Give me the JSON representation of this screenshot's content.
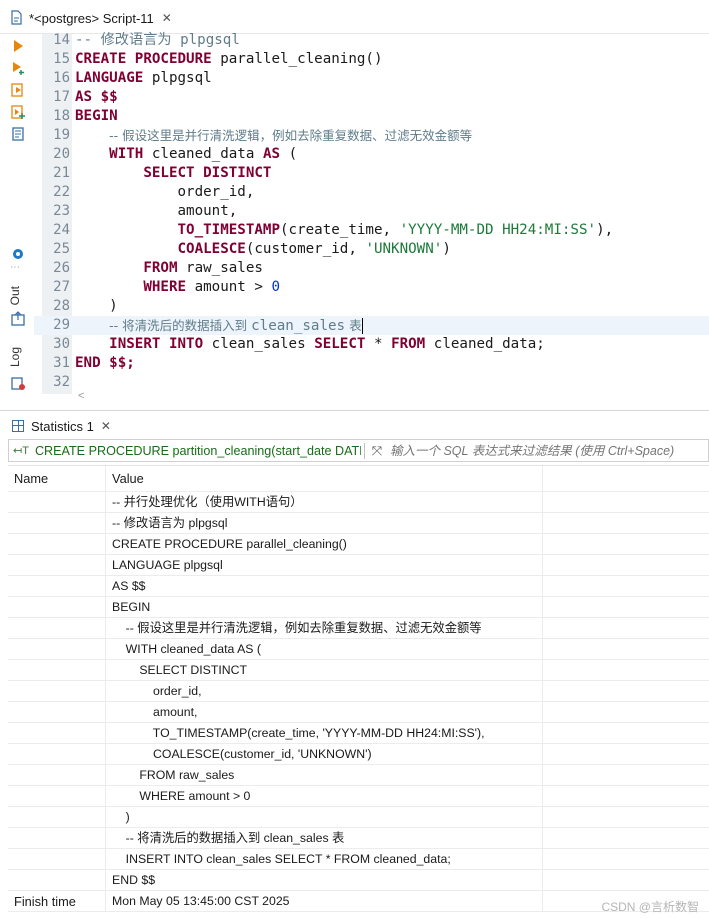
{
  "editor_tab": {
    "title": "*<postgres> Script-11",
    "close": "✕"
  },
  "side_panels": {
    "out": "Out",
    "log": "Log"
  },
  "code_lines": [
    {
      "num": "14",
      "segments": [
        {
          "t": "cm",
          "v": "-- 修改语言为 plpgsql"
        }
      ]
    },
    {
      "num": "15",
      "segments": [
        {
          "t": "kw",
          "v": "CREATE PROCEDURE"
        },
        {
          "t": "",
          "v": " parallel_cleaning()"
        }
      ]
    },
    {
      "num": "16",
      "segments": [
        {
          "t": "kw",
          "v": "LANGUAGE"
        },
        {
          "t": "",
          "v": " plpgsql"
        }
      ]
    },
    {
      "num": "17",
      "segments": [
        {
          "t": "kw",
          "v": "AS $$"
        }
      ]
    },
    {
      "num": "18",
      "segments": [
        {
          "t": "kw",
          "v": "BEGIN"
        }
      ]
    },
    {
      "num": "19",
      "segments": [
        {
          "t": "",
          "v": "    "
        },
        {
          "t": "cmx",
          "v": "-- 假设这里是并行清洗逻辑，例如去除重复数据、过滤无效金额等"
        }
      ]
    },
    {
      "num": "20",
      "segments": [
        {
          "t": "",
          "v": "    "
        },
        {
          "t": "kw",
          "v": "WITH"
        },
        {
          "t": "",
          "v": " cleaned_data "
        },
        {
          "t": "kw",
          "v": "AS"
        },
        {
          "t": "",
          "v": " ("
        }
      ]
    },
    {
      "num": "21",
      "segments": [
        {
          "t": "",
          "v": "        "
        },
        {
          "t": "kw",
          "v": "SELECT DISTINCT"
        }
      ]
    },
    {
      "num": "22",
      "segments": [
        {
          "t": "",
          "v": "            order_id,"
        }
      ]
    },
    {
      "num": "23",
      "segments": [
        {
          "t": "",
          "v": "            amount,"
        }
      ]
    },
    {
      "num": "24",
      "segments": [
        {
          "t": "",
          "v": "            "
        },
        {
          "t": "kw",
          "v": "TO_TIMESTAMP"
        },
        {
          "t": "",
          "v": "(create_time, "
        },
        {
          "t": "st",
          "v": "'YYYY-MM-DD HH24:MI:SS'"
        },
        {
          "t": "",
          "v": "),"
        }
      ]
    },
    {
      "num": "25",
      "segments": [
        {
          "t": "",
          "v": "            "
        },
        {
          "t": "kw",
          "v": "COALESCE"
        },
        {
          "t": "",
          "v": "(customer_id, "
        },
        {
          "t": "st",
          "v": "'UNKNOWN'"
        },
        {
          "t": "",
          "v": ")"
        }
      ]
    },
    {
      "num": "26",
      "segments": [
        {
          "t": "",
          "v": "        "
        },
        {
          "t": "kw",
          "v": "FROM"
        },
        {
          "t": "",
          "v": " raw_sales"
        }
      ]
    },
    {
      "num": "27",
      "segments": [
        {
          "t": "",
          "v": "        "
        },
        {
          "t": "kw",
          "v": "WHERE"
        },
        {
          "t": "",
          "v": " amount > "
        },
        {
          "t": "nm",
          "v": "0"
        }
      ]
    },
    {
      "num": "28",
      "segments": [
        {
          "t": "",
          "v": "    )"
        }
      ]
    },
    {
      "num": "29",
      "segments": [
        {
          "t": "",
          "v": "    "
        },
        {
          "t": "cmx",
          "v": "-- 将清洗后的数据插入到 "
        },
        {
          "t": "cm",
          "v": "clean_sales"
        },
        {
          "t": "cmx",
          "v": " 表"
        }
      ],
      "current": true
    },
    {
      "num": "30",
      "segments": [
        {
          "t": "",
          "v": "    "
        },
        {
          "t": "kw",
          "v": "INSERT INTO"
        },
        {
          "t": "",
          "v": " clean_sales "
        },
        {
          "t": "kw",
          "v": "SELECT"
        },
        {
          "t": "",
          "v": " * "
        },
        {
          "t": "kw",
          "v": "FROM"
        },
        {
          "t": "",
          "v": " cleaned_data;"
        }
      ]
    },
    {
      "num": "31",
      "segments": [
        {
          "t": "kw",
          "v": "END $$;"
        }
      ]
    },
    {
      "num": "32",
      "segments": []
    }
  ],
  "results": {
    "tab_label": "Statistics 1",
    "tab_close": "✕",
    "query_text": "CREATE PROCEDURE partition_cleaning(start_date DATE,",
    "filter_placeholder": "输入一个 SQL 表达式来过滤结果 (使用 Ctrl+Space)",
    "columns": [
      "Name",
      "Value"
    ],
    "rows": [
      {
        "name": "",
        "value": "-- 并行处理优化（使用WITH语句）"
      },
      {
        "name": "",
        "value": "-- 修改语言为 plpgsql"
      },
      {
        "name": "",
        "value": "CREATE PROCEDURE parallel_cleaning()"
      },
      {
        "name": "",
        "value": "LANGUAGE plpgsql"
      },
      {
        "name": "",
        "value": "AS $$"
      },
      {
        "name": "",
        "value": "BEGIN"
      },
      {
        "name": "",
        "value": "    -- 假设这里是并行清洗逻辑，例如去除重复数据、过滤无效金额等"
      },
      {
        "name": "",
        "value": "    WITH cleaned_data AS ("
      },
      {
        "name": "",
        "value": "        SELECT DISTINCT"
      },
      {
        "name": "",
        "value": "            order_id,"
      },
      {
        "name": "",
        "value": "            amount,"
      },
      {
        "name": "",
        "value": "            TO_TIMESTAMP(create_time, 'YYYY-MM-DD HH24:MI:SS'),"
      },
      {
        "name": "",
        "value": "            COALESCE(customer_id, 'UNKNOWN')"
      },
      {
        "name": "",
        "value": "        FROM raw_sales"
      },
      {
        "name": "",
        "value": "        WHERE amount > 0"
      },
      {
        "name": "",
        "value": "    )"
      },
      {
        "name": "",
        "value": "    -- 将清洗后的数据插入到 clean_sales 表"
      },
      {
        "name": "",
        "value": "    INSERT INTO clean_sales SELECT * FROM cleaned_data;"
      },
      {
        "name": "",
        "value": "END $$"
      },
      {
        "name": "Finish time",
        "value": "Mon May 05 13:45:00 CST 2025"
      }
    ]
  },
  "watermark": "CSDN @言析数智",
  "colors": {
    "keyword": "#7f0033",
    "string": "#1d7a3a",
    "comment": "#5f7c8a",
    "number": "#0033cc",
    "toolbar_orange": "#e8850c",
    "accent_blue": "#3a6ea5"
  }
}
